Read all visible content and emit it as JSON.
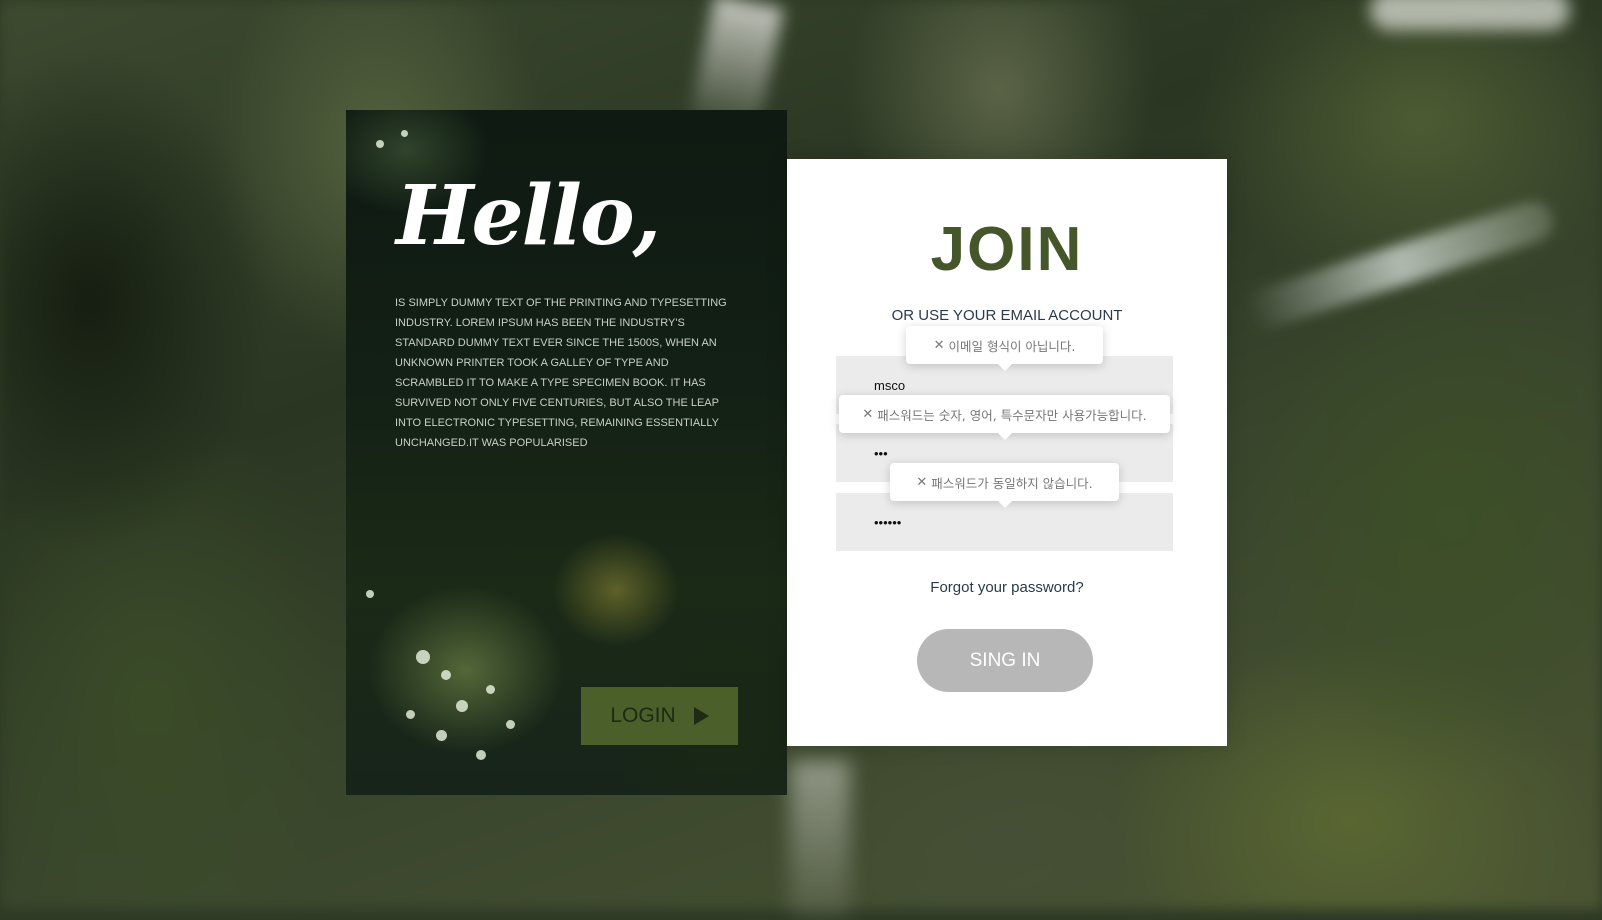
{
  "colors": {
    "accent": "#44562a",
    "login_button": "#4a5f29",
    "signin_button": "#b7b7b7",
    "input_bg": "#ebebeb"
  },
  "left_panel": {
    "heading": "Hello,",
    "description": "IS SIMPLY DUMMY TEXT OF THE PRINTING AND TYPESETTING INDUSTRY. LOREM IPSUM HAS BEEN THE INDUSTRY'S STANDARD DUMMY TEXT EVER SINCE THE 1500S, WHEN AN UNKNOWN PRINTER TOOK A GALLEY OF TYPE AND SCRAMBLED IT TO MAKE A TYPE SPECIMEN BOOK. IT HAS SURVIVED NOT ONLY FIVE CENTURIES, BUT ALSO THE LEAP INTO ELECTRONIC TYPESETTING, REMAINING ESSENTIALLY UNCHANGED.IT WAS POPULARISED",
    "login_label": "LOGIN",
    "login_icon": "play-icon"
  },
  "form": {
    "title": "JOIN",
    "subtitle": "OR USE YOUR EMAIL ACCOUNT",
    "email_value": "msco",
    "password_value": "•••",
    "confirm_value": "••••••",
    "errors": {
      "email": "이메일 형식이 아닙니다.",
      "password": "패스워드는 숫자, 영어, 특수문자만 사용가능합니다.",
      "confirm": "패스워드가 동일하지 않습니다."
    },
    "error_icon": "close-icon",
    "error_icon_glyph": "✕",
    "forgot": "Forgot your password?",
    "signin_label": "SING IN"
  }
}
